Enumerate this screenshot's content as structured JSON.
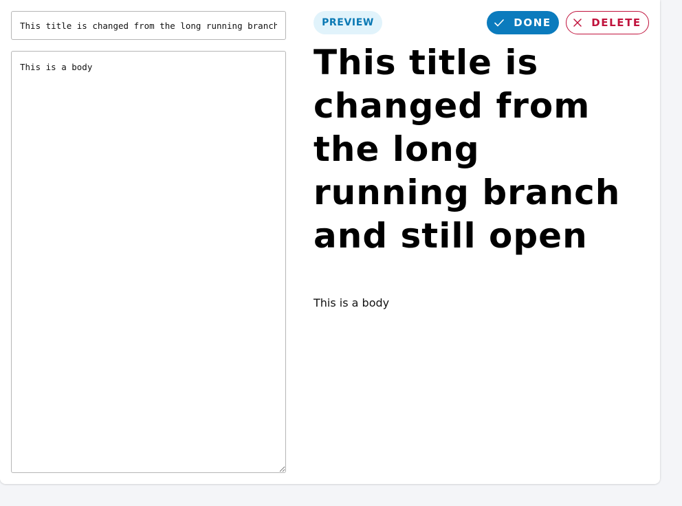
{
  "editor": {
    "title_value": "This title is changed from the long running branch and still open",
    "body_value": "This is a body"
  },
  "toolbar": {
    "preview_label": "PREVIEW",
    "done_label": "DONE",
    "delete_label": "DELETE",
    "done_icon": "check-icon",
    "delete_icon": "close-icon"
  },
  "preview": {
    "title": "This title is changed from the long running branch and still open",
    "body": "This is a body"
  },
  "colors": {
    "primary": "#0b7bbd",
    "preview_bg": "#e1f3fb",
    "preview_text": "#0a79b4",
    "danger": "#c0123c"
  }
}
